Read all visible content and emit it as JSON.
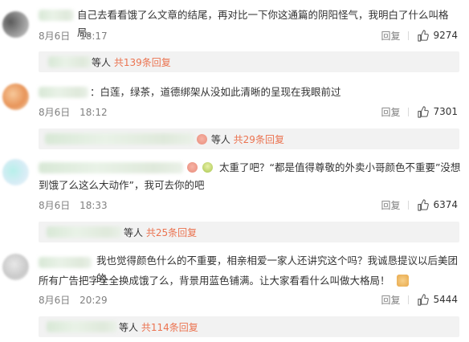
{
  "comments": [
    {
      "text": "自己去看看饿了么文章的结尾，再对比一下你这通篇的阴阳怪气，我明白了什么叫格局。",
      "date": "8月6日",
      "time": "18:17",
      "reply_label": "回复",
      "like_count": "9274",
      "replies_suffix": "等人",
      "replies_link": "共139条回复"
    },
    {
      "text": "：白莲，绿茶，道德绑架从没如此清晰的呈现在我眼前过",
      "date": "8月6日",
      "time": "18:12",
      "reply_label": "回复",
      "like_count": "7301",
      "replies_suffix": "等人",
      "replies_link": "共29条回复"
    },
    {
      "text_line1": "太重了吧？“都是值得尊敬的外卖小哥颜色不重要”没想",
      "text_line2": "到饿了么这么大动作”，我可去你的吧",
      "date": "8月6日",
      "time": "18:33",
      "reply_label": "回复",
      "like_count": "6374",
      "replies_suffix": "等人",
      "replies_link": "共25条回复"
    },
    {
      "text_line1": "我也觉得颜色什么的不重要，相亲相爱一家人还讲究这个吗？我诚恳提议以后美团的",
      "text_line2": "所有广告把字全全换成饿了么，背景用蓝色铺满。让大家看看什么叫做大格局！",
      "date": "8月6日",
      "time": "20:29",
      "reply_label": "回复",
      "like_count": "5444",
      "replies_suffix": "等人",
      "replies_link": "共114条回复"
    }
  ],
  "icons": {
    "like": "thumbs-up-icon",
    "emoji_pig": "pig-face-emoji",
    "emoji_teacup": "green-face-emoji",
    "emoji_thumb": "thumbs-up-emoji"
  },
  "colors": {
    "link": "#eb7350",
    "meta": "#808080",
    "subbox_bg": "#f2f2f2"
  }
}
